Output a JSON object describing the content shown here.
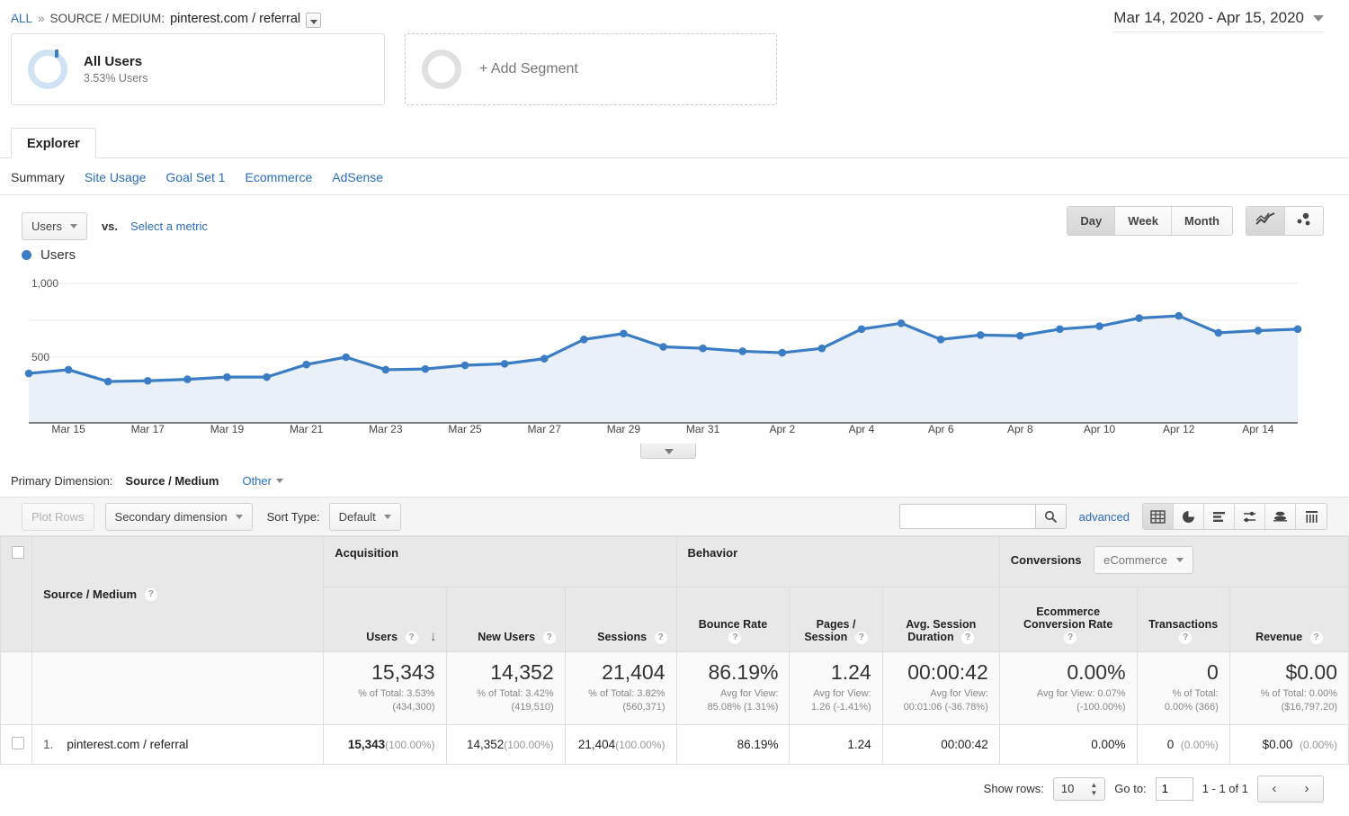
{
  "breadcrumb": {
    "all": "ALL",
    "separator": "»",
    "dimension_label": "SOURCE / MEDIUM:",
    "dimension_value": "pinterest.com / referral"
  },
  "date_range": {
    "value": "Mar 14, 2020 - Apr 15, 2020"
  },
  "segments": [
    {
      "title": "All Users",
      "subtitle": "3.53% Users"
    },
    {
      "title": "+ Add Segment"
    }
  ],
  "explorer_tab": "Explorer",
  "subtabs": [
    {
      "label": "Summary",
      "active": true
    },
    {
      "label": "Site Usage",
      "active": false
    },
    {
      "label": "Goal Set 1",
      "active": false
    },
    {
      "label": "Ecommerce",
      "active": false
    },
    {
      "label": "AdSense",
      "active": false
    }
  ],
  "metric_toolbar": {
    "metric": "Users",
    "vs": "vs.",
    "select_metric": "Select a metric",
    "granularity": [
      {
        "label": "Day",
        "selected": true
      },
      {
        "label": "Week",
        "selected": false
      },
      {
        "label": "Month",
        "selected": false
      }
    ],
    "chart_type_icons": [
      {
        "name": "line-chart-icon",
        "selected": true
      },
      {
        "name": "motion-chart-icon",
        "selected": false
      }
    ]
  },
  "legend": {
    "label": "Users"
  },
  "chart_data": {
    "type": "line",
    "title": "Users",
    "xlabel": "",
    "ylabel": "Users",
    "ylim": [
      0,
      1000
    ],
    "yticks": [
      500,
      1000
    ],
    "ytick_labels": [
      "500",
      "1,000"
    ],
    "grid": true,
    "legend_position": "top-left",
    "x": [
      "Mar 14",
      "Mar 15",
      "Mar 16",
      "Mar 17",
      "Mar 18",
      "Mar 19",
      "Mar 20",
      "Mar 21",
      "Mar 22",
      "Mar 23",
      "Mar 24",
      "Mar 25",
      "Mar 26",
      "Mar 27",
      "Mar 28",
      "Mar 29",
      "Mar 30",
      "Mar 31",
      "Apr 1",
      "Apr 2",
      "Apr 3",
      "Apr 4",
      "Apr 5",
      "Apr 6",
      "Apr 7",
      "Apr 8",
      "Apr 9",
      "Apr 10",
      "Apr 11",
      "Apr 12",
      "Apr 13",
      "Apr 14",
      "Apr 15"
    ],
    "xtick_labels": [
      "Mar 15",
      "Mar 17",
      "Mar 19",
      "Mar 21",
      "Mar 23",
      "Mar 25",
      "Mar 27",
      "Mar 29",
      "Mar 31",
      "Apr 2",
      "Apr 4",
      "Apr 6",
      "Apr 8",
      "Apr 10",
      "Apr 12",
      "Apr 14"
    ],
    "series": [
      {
        "name": "Users",
        "color": "#3b7dc4",
        "values": [
          390,
          415,
          335,
          340,
          350,
          365,
          365,
          450,
          500,
          415,
          420,
          445,
          455,
          490,
          620,
          660,
          570,
          560,
          540,
          530,
          560,
          690,
          730,
          620,
          650,
          645,
          690,
          710,
          765,
          780,
          665,
          680,
          690
        ]
      }
    ]
  },
  "primary_dimension": {
    "label": "Primary Dimension:",
    "current": "Source / Medium",
    "other": "Other"
  },
  "table_toolbar": {
    "plot_rows": "Plot Rows",
    "secondary_dimension": "Secondary dimension",
    "sort_type_label": "Sort Type:",
    "sort_type_value": "Default",
    "search_placeholder": "",
    "search_value": "",
    "advanced": "advanced",
    "view_icons": [
      {
        "name": "table-view-icon",
        "selected": true
      },
      {
        "name": "pie-view-icon",
        "selected": false
      },
      {
        "name": "performance-view-icon",
        "selected": false
      },
      {
        "name": "comparison-view-icon",
        "selected": false
      },
      {
        "name": "pivot-view-icon",
        "selected": false
      },
      {
        "name": "term-cloud-view-icon",
        "selected": false
      }
    ]
  },
  "table": {
    "groups": [
      {
        "label": "Acquisition",
        "span": 3
      },
      {
        "label": "Behavior",
        "span": 3
      },
      {
        "label": "Conversions",
        "span": 3,
        "select_value": "eCommerce"
      }
    ],
    "dimension_header": "Source / Medium",
    "columns": [
      {
        "label": "Users",
        "sorted": true
      },
      {
        "label": "New Users"
      },
      {
        "label": "Sessions"
      },
      {
        "label": "Bounce Rate"
      },
      {
        "label": "Pages / Session"
      },
      {
        "label": "Avg. Session Duration"
      },
      {
        "label": "Ecommerce Conversion Rate"
      },
      {
        "label": "Transactions"
      },
      {
        "label": "Revenue"
      }
    ],
    "totals": [
      {
        "value": "15,343",
        "sub": "% of Total: 3.53% (434,300)"
      },
      {
        "value": "14,352",
        "sub": "% of Total: 3.42% (419,510)"
      },
      {
        "value": "21,404",
        "sub": "% of Total: 3.82% (560,371)"
      },
      {
        "value": "86.19%",
        "sub": "Avg for View: 85.08% (1.31%)"
      },
      {
        "value": "1.24",
        "sub": "Avg for View: 1.26 (-1.41%)"
      },
      {
        "value": "00:00:42",
        "sub": "Avg for View: 00:01:06 (-36.78%)"
      },
      {
        "value": "0.00%",
        "sub": "Avg for View: 0.07% (-100.00%)"
      },
      {
        "value": "0",
        "sub": "% of Total: 0.00% (366)"
      },
      {
        "value": "$0.00",
        "sub": "% of Total: 0.00% ($16,797.20)"
      }
    ],
    "rows": [
      {
        "index": "1.",
        "name": "pinterest.com / referral",
        "users": "15,343",
        "users_pct": "(100.00%)",
        "new_users": "14,352",
        "new_users_pct": "(100.00%)",
        "sessions": "21,404",
        "sessions_pct": "(100.00%)",
        "bounce_rate": "86.19%",
        "pages_session": "1.24",
        "avg_duration": "00:00:42",
        "ecom_rate": "0.00%",
        "transactions": "0",
        "transactions_pct": "(0.00%)",
        "revenue": "$0.00",
        "revenue_pct": "(0.00%)"
      }
    ]
  },
  "footer": {
    "show_rows_label": "Show rows:",
    "show_rows_value": "10",
    "goto_label": "Go to:",
    "goto_value": "1",
    "range": "1 - 1 of 1",
    "prev": "‹",
    "next": "›"
  },
  "colors": {
    "accent": "#3b7dc4",
    "link": "#2a6ebb",
    "area_fill": "#e9f0f8"
  }
}
